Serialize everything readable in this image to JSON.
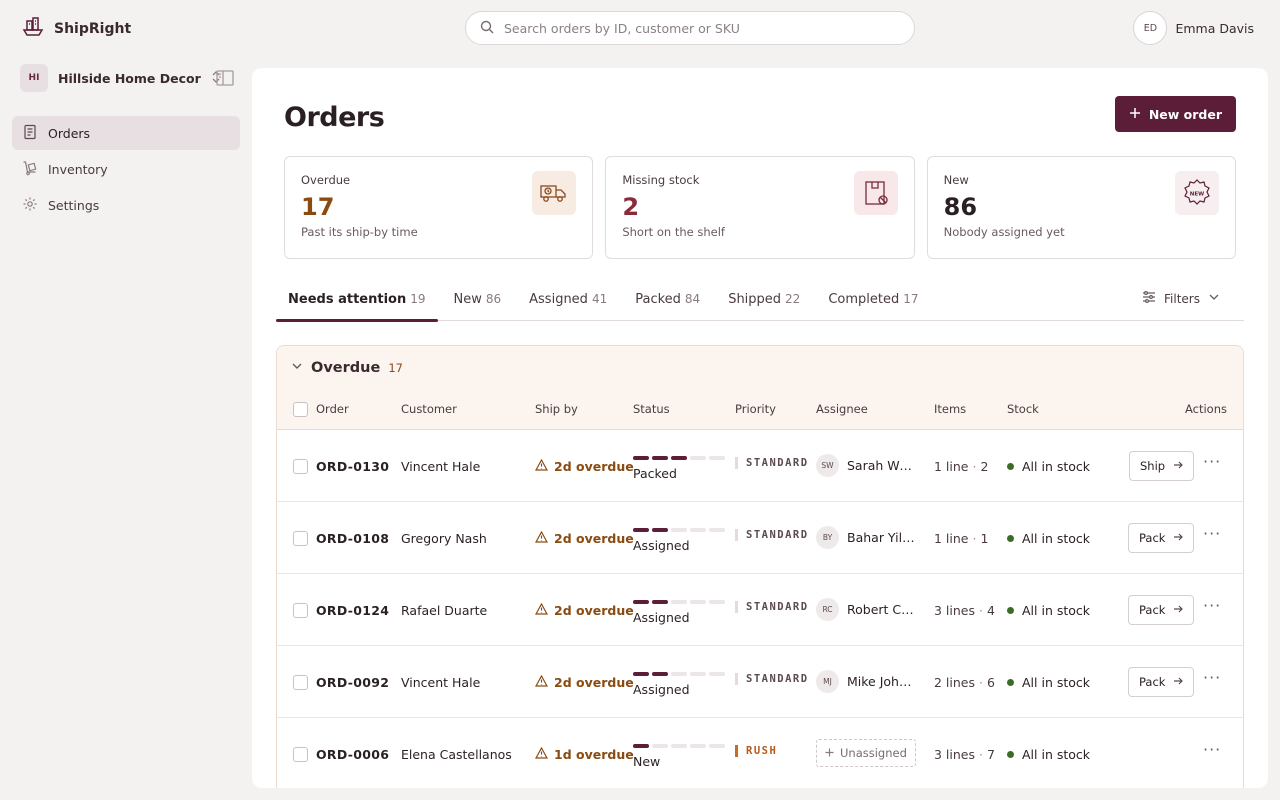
{
  "app": {
    "name": "ShipRight"
  },
  "search": {
    "placeholder": "Search orders by ID, customer or SKU"
  },
  "user": {
    "initials": "ED",
    "name": "Emma Davis"
  },
  "workspace": {
    "initials": "HI",
    "name": "Hillside Home Decor"
  },
  "nav": [
    {
      "label": "Orders",
      "icon": "document-icon",
      "active": true
    },
    {
      "label": "Inventory",
      "icon": "dolly-icon",
      "active": false
    },
    {
      "label": "Settings",
      "icon": "gear-icon",
      "active": false
    }
  ],
  "page": {
    "title": "Orders",
    "new_order_label": "New order"
  },
  "cards": [
    {
      "label": "Overdue",
      "value": "17",
      "sub": "Past its ship-by time",
      "icon": "truck-clock-icon",
      "value_color": "#8a4a10",
      "icon_bg": "#f8ebe1"
    },
    {
      "label": "Missing stock",
      "value": "2",
      "sub": "Short on the shelf",
      "icon": "box-blocked-icon",
      "value_color": "#8a2a3a",
      "icon_bg": "#f8e8ea"
    },
    {
      "label": "New",
      "value": "86",
      "sub": "Nobody assigned yet",
      "icon": "new-badge-icon",
      "value_color": "#2a1f23",
      "icon_bg": "#f6eeef"
    }
  ],
  "tabs": [
    {
      "label": "Needs attention",
      "count": "19"
    },
    {
      "label": "New",
      "count": "86"
    },
    {
      "label": "Assigned",
      "count": "41"
    },
    {
      "label": "Packed",
      "count": "84"
    },
    {
      "label": "Shipped",
      "count": "22"
    },
    {
      "label": "Completed",
      "count": "17"
    }
  ],
  "filters_label": "Filters",
  "group": {
    "title": "Overdue",
    "count": "17",
    "columns": {
      "order": "Order",
      "customer": "Customer",
      "ship_by": "Ship by",
      "status": "Status",
      "priority": "Priority",
      "assignee": "Assignee",
      "items": "Items",
      "stock": "Stock",
      "actions": "Actions"
    }
  },
  "rows": [
    {
      "id": "ORD-0130",
      "customer": "Vincent Hale",
      "ship_by": "2d overdue",
      "progress": 3,
      "status": "Packed",
      "priority": "STANDARD",
      "assignee_initials": "SW",
      "assignee": "Sarah Williams",
      "lines": "1 line",
      "qty": "2",
      "stock": "All in stock",
      "action": "Ship"
    },
    {
      "id": "ORD-0108",
      "customer": "Gregory Nash",
      "ship_by": "2d overdue",
      "progress": 2,
      "status": "Assigned",
      "priority": "STANDARD",
      "assignee_initials": "BY",
      "assignee": "Bahar Yilmaz",
      "lines": "1 line",
      "qty": "1",
      "stock": "All in stock",
      "action": "Pack"
    },
    {
      "id": "ORD-0124",
      "customer": "Rafael Duarte",
      "ship_by": "2d overdue",
      "progress": 2,
      "status": "Assigned",
      "priority": "STANDARD",
      "assignee_initials": "RC",
      "assignee": "Robert Chen",
      "lines": "3 lines",
      "qty": "4",
      "stock": "All in stock",
      "action": "Pack"
    },
    {
      "id": "ORD-0092",
      "customer": "Vincent Hale",
      "ship_by": "2d overdue",
      "progress": 2,
      "status": "Assigned",
      "priority": "STANDARD",
      "assignee_initials": "MJ",
      "assignee": "Mike Johnson",
      "lines": "2 lines",
      "qty": "6",
      "stock": "All in stock",
      "action": "Pack"
    },
    {
      "id": "ORD-0006",
      "customer": "Elena Castellanos",
      "ship_by": "1d overdue",
      "progress": 1,
      "status": "New",
      "priority": "RUSH",
      "assignee_initials": "",
      "assignee": "Unassigned",
      "lines": "3 lines",
      "qty": "7",
      "stock": "All in stock",
      "action": ""
    }
  ]
}
